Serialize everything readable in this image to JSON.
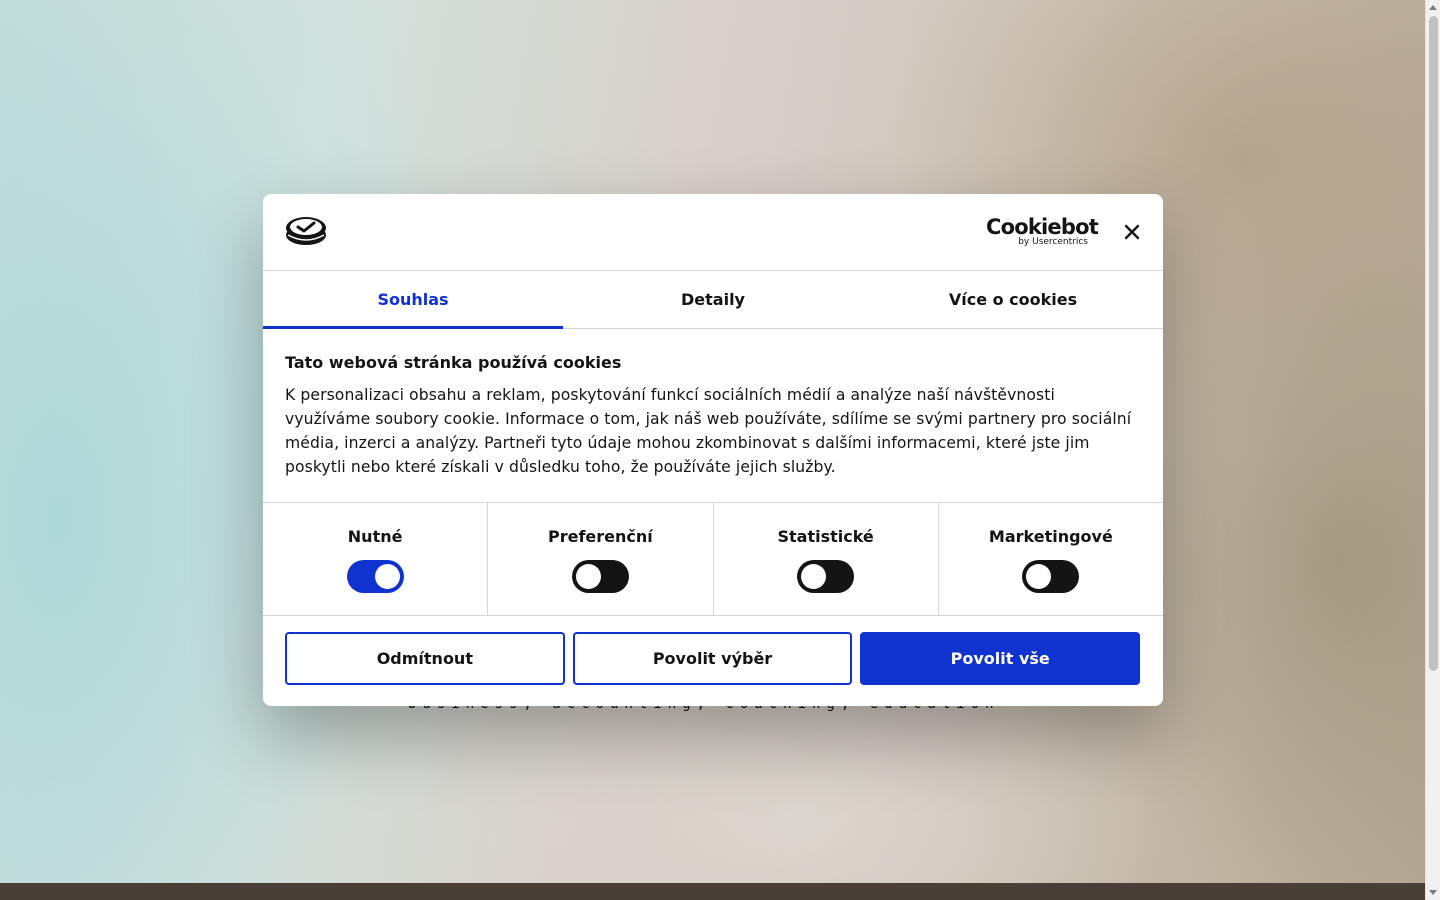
{
  "page": {
    "hero_text": "business, accounting, coaching, education"
  },
  "dialog": {
    "brand": {
      "name": "Cookiebot",
      "sub": "by Usercentrics"
    },
    "icons": {
      "logo": "cookie-logo-icon",
      "close": "close-icon"
    },
    "tabs": [
      {
        "label": "Souhlas",
        "active": true
      },
      {
        "label": "Detaily",
        "active": false
      },
      {
        "label": "Více o cookies",
        "active": false
      }
    ],
    "title": "Tato webová stránka používá cookies",
    "body": "K personalizaci obsahu a reklam, poskytování funkcí sociálních médií a analýze naší návštěvnosti využíváme soubory cookie. Informace o tom, jak náš web používáte, sdílíme se svými partnery pro sociální média, inzerci a analýzy. Partneři tyto údaje mohou zkombinovat s dalšími informacemi, které jste jim poskytli nebo které získali v důsledku toho, že používáte jejich služby.",
    "categories": [
      {
        "label": "Nutné",
        "enabled": true
      },
      {
        "label": "Preferenční",
        "enabled": false
      },
      {
        "label": "Statistické",
        "enabled": false
      },
      {
        "label": "Marketingové",
        "enabled": false
      }
    ],
    "buttons": {
      "decline": "Odmítnout",
      "allow_selection": "Povolit výběr",
      "allow_all": "Povolit vše"
    }
  },
  "colors": {
    "accent": "#1032cf",
    "text": "#141414",
    "toggle_off": "#141414",
    "footer": "#4a3f36"
  }
}
